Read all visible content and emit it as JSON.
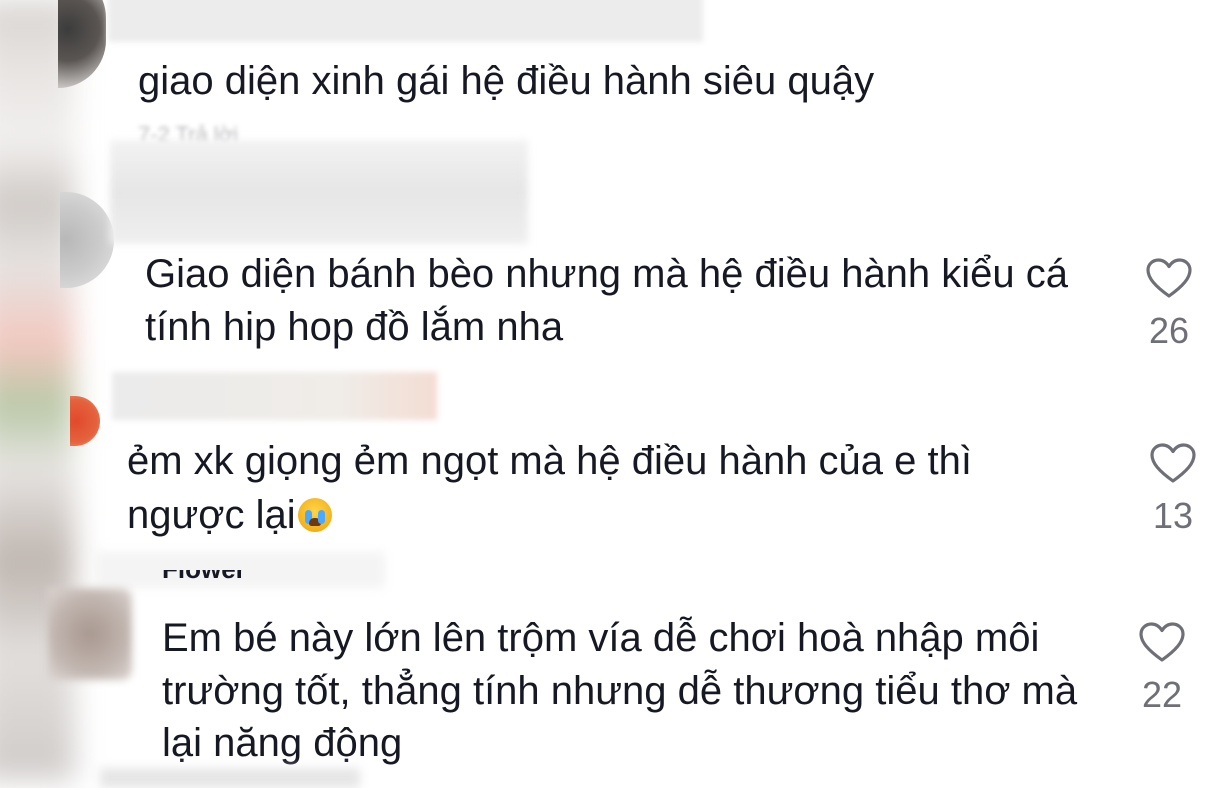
{
  "comments": [
    {
      "text": "giao diện xinh gái hệ điều hành siêu quậy",
      "meta": "7-2   Trả lời"
    },
    {
      "text_line1": "Giao diện bánh bèo nhưng mà hệ điều hành kiểu cá",
      "text_line2": "tính hip hop đồ lắm nha",
      "likes": "26"
    },
    {
      "text_line1": "ẻm xk giọng ẻm ngọt mà hệ điều hành của e thì",
      "text_line2": "ngược lại",
      "emoji": "loudly-crying-face",
      "likes": "13"
    },
    {
      "username_partial": "Flower",
      "text_line1": "Em bé này lớn lên trộm vía dễ chơi hoà nhập môi",
      "text_line2": "trường tốt, thẳng tính nhưng dễ thương tiểu thơ mà",
      "text_line3": "lại năng động",
      "likes": "22"
    }
  ],
  "icons": {
    "like": "heart-outline-icon"
  },
  "colors": {
    "text": "#161823",
    "count": "#6f7077",
    "heart": "#6f7077"
  }
}
